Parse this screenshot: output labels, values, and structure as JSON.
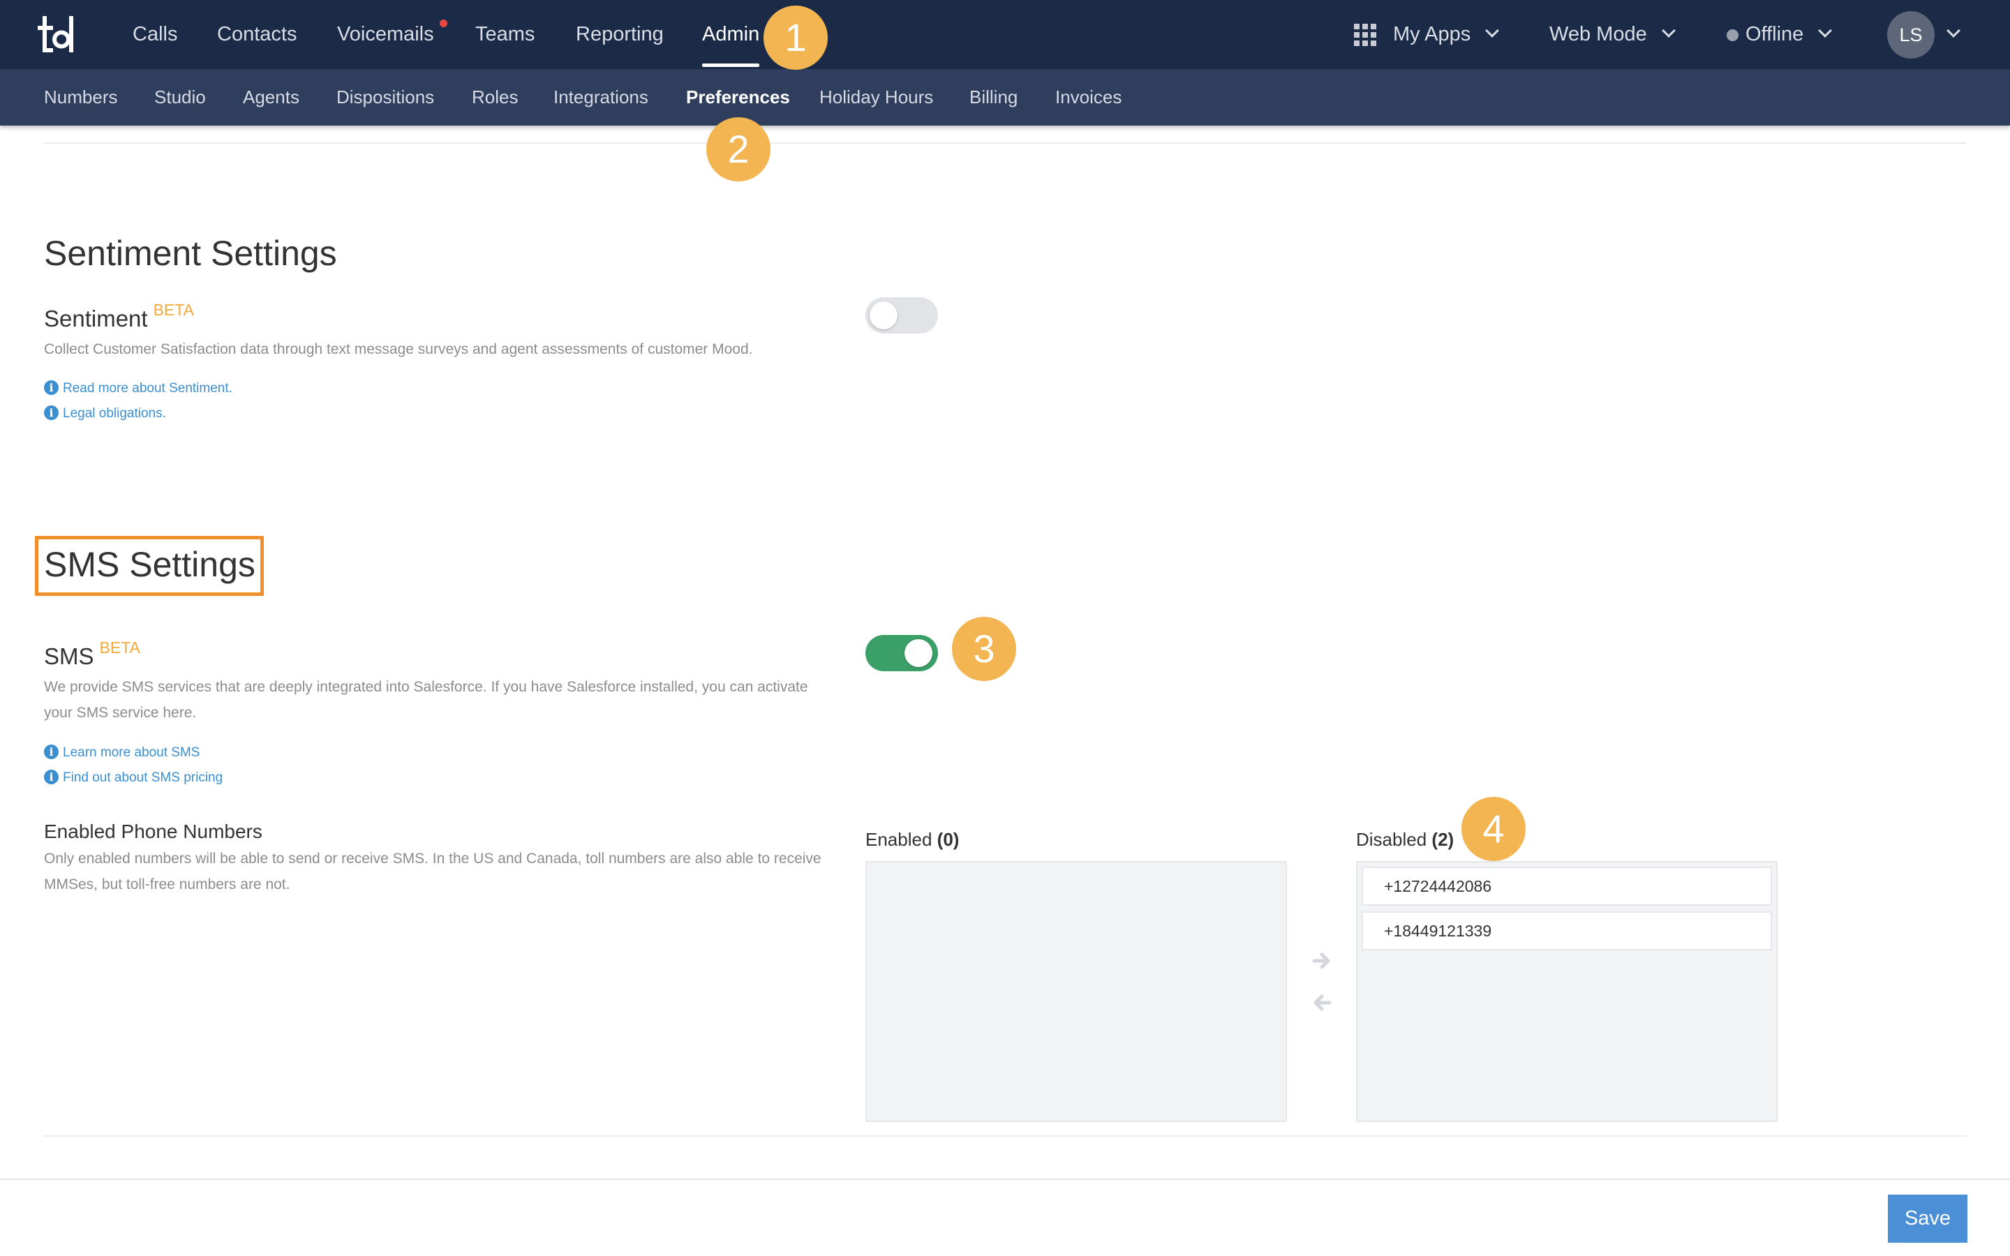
{
  "topnav": {
    "logo_text": "td",
    "items": [
      {
        "label": "Calls"
      },
      {
        "label": "Contacts"
      },
      {
        "label": "Voicemails"
      },
      {
        "label": "Teams"
      },
      {
        "label": "Reporting"
      },
      {
        "label": "Admin",
        "active": true
      }
    ],
    "right": {
      "apps": "My Apps",
      "mode": "Web Mode",
      "status": "Offline",
      "avatar_initials": "LS"
    }
  },
  "subnav": {
    "items": [
      {
        "label": "Numbers"
      },
      {
        "label": "Studio"
      },
      {
        "label": "Agents"
      },
      {
        "label": "Dispositions"
      },
      {
        "label": "Roles"
      },
      {
        "label": "Integrations"
      },
      {
        "label": "Preferences",
        "active": true
      },
      {
        "label": "Holiday Hours"
      },
      {
        "label": "Billing"
      },
      {
        "label": "Invoices"
      }
    ]
  },
  "badges": [
    "1",
    "2",
    "3",
    "4"
  ],
  "sentiment": {
    "section_title": "Sentiment Settings",
    "label": "Sentiment",
    "beta": "BETA",
    "description": "Collect Customer Satisfaction data through text message surveys and agent assessments of customer Mood.",
    "links": [
      "Read more about Sentiment.",
      "Legal obligations."
    ],
    "enabled": false
  },
  "sms": {
    "section_title": "SMS Settings",
    "label": "SMS",
    "beta": "BETA",
    "description": "We provide SMS services that are deeply integrated into Salesforce. If you have Salesforce installed, you can activate your SMS service here.",
    "links": [
      "Learn more about SMS",
      "Find out about SMS pricing"
    ],
    "enabled": true
  },
  "phone_numbers": {
    "label": "Enabled Phone Numbers",
    "description": "Only enabled numbers will be able to send or receive SMS. In the US and Canada, toll numbers are also able to receive MMSes, but toll-free numbers are not.",
    "enabled_label": "Enabled",
    "enabled_count": "(0)",
    "disabled_label": "Disabled",
    "disabled_count": "(2)",
    "enabled": [],
    "disabled": [
      "+12724442086",
      "+18449121339"
    ]
  },
  "footer": {
    "save_label": "Save"
  },
  "colors": {
    "topbar": "#1b2a47",
    "subbar": "#2f3e5d",
    "badge": "#f2b552",
    "highlight_box": "#f0902d",
    "toggle_on": "#3aa067",
    "link": "#3a8fd1",
    "beta": "#f4a93b",
    "save_button": "#4b8fd6"
  },
  "icons": {
    "apps": "grid-icon",
    "chevron": "chevron-down-icon",
    "info": "info-icon",
    "move_right": "arrow-right-icon",
    "move_left": "arrow-left-icon"
  }
}
